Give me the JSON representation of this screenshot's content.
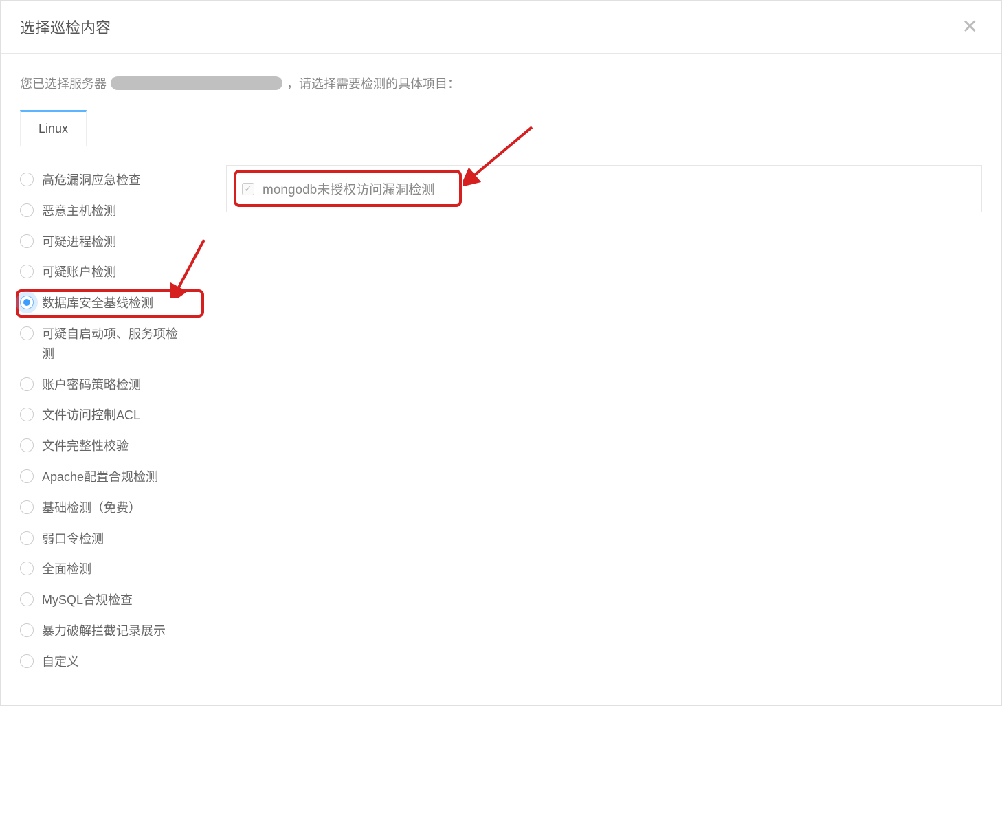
{
  "modal": {
    "title": "选择巡检内容",
    "intro_prefix": "您已选择服务器",
    "intro_suffix": "，请选择需要检测的具体项目：",
    "tab_label": "Linux"
  },
  "radios": {
    "items": [
      {
        "label": "高危漏洞应急检查"
      },
      {
        "label": "恶意主机检测"
      },
      {
        "label": "可疑进程检测"
      },
      {
        "label": "可疑账户检测"
      },
      {
        "label": "数据库安全基线检测"
      },
      {
        "label": "可疑自启动项、服务项检测"
      },
      {
        "label": "账户密码策略检测"
      },
      {
        "label": "文件访问控制ACL"
      },
      {
        "label": "文件完整性校验"
      },
      {
        "label": "Apache配置合规检测"
      },
      {
        "label": "基础检测（免费）"
      },
      {
        "label": "弱口令检测"
      },
      {
        "label": "全面检测"
      },
      {
        "label": "MySQL合规检查"
      },
      {
        "label": "暴力破解拦截记录展示"
      },
      {
        "label": "自定义"
      }
    ],
    "selected_index": 4
  },
  "detail": {
    "checkbox_label": "mongodb未授权访问漏洞检测",
    "checked": true
  }
}
